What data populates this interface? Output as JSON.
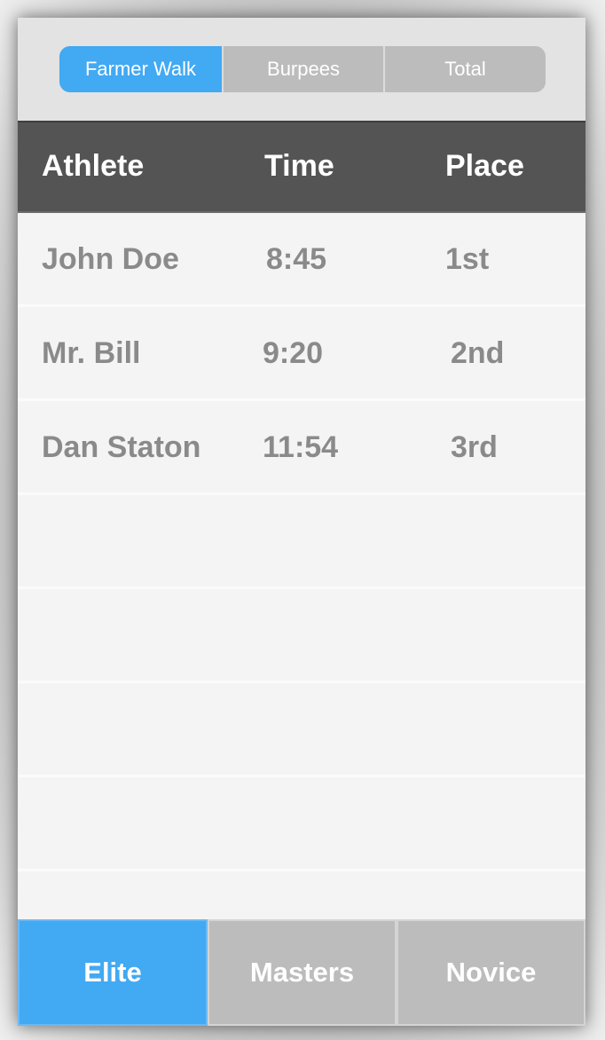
{
  "event_tabs": [
    {
      "label": "Farmer Walk",
      "active": true
    },
    {
      "label": "Burpees",
      "active": false
    },
    {
      "label": "Total",
      "active": false
    }
  ],
  "table": {
    "headers": {
      "athlete": "Athlete",
      "time": "Time",
      "place": "Place"
    },
    "rows": [
      {
        "athlete": "John Doe",
        "time": "8:45",
        "place": "1st"
      },
      {
        "athlete": "Mr. Bill",
        "time": "9:20",
        "place": "2nd"
      },
      {
        "athlete": "Dan Staton",
        "time": "11:54",
        "place": "3rd"
      },
      {
        "athlete": "",
        "time": "",
        "place": ""
      },
      {
        "athlete": "",
        "time": "",
        "place": ""
      },
      {
        "athlete": "",
        "time": "",
        "place": ""
      },
      {
        "athlete": "",
        "time": "",
        "place": ""
      }
    ]
  },
  "division_tabs": [
    {
      "label": "Elite",
      "active": true
    },
    {
      "label": "Masters",
      "active": false
    },
    {
      "label": "Novice",
      "active": false
    }
  ],
  "colors": {
    "accent": "#42a9f3",
    "inactive_tab": "#bcbcbc",
    "header_bg": "#545454",
    "row_text": "#8a8a8a"
  }
}
